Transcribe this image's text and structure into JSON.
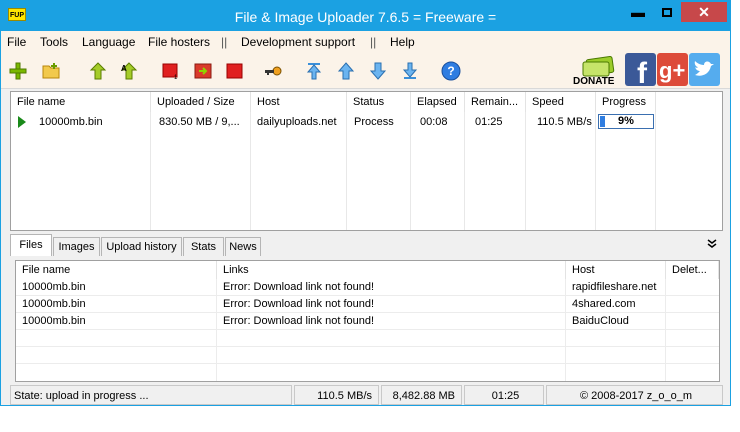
{
  "window": {
    "icon_text": "FUP",
    "title": "File & Image Uploader 7.6.5  = Freeware ="
  },
  "menu": [
    "File",
    "Tools",
    "Language",
    "File hosters",
    "||",
    "Development support",
    "||",
    "Help"
  ],
  "toolbar": {
    "donate_label": "DONATE"
  },
  "uploads": {
    "columns": [
      "File name",
      "Uploaded / Size",
      "Host",
      "Status",
      "Elapsed",
      "Remain...",
      "Speed",
      "Progress"
    ],
    "rows": [
      {
        "file": "10000mb.bin",
        "uploaded": "830.50 MB / 9,...",
        "host": "dailyuploads.net",
        "status": "Process",
        "elapsed": "00:08",
        "remaining": "01:25",
        "speed": "110.5 MB/s",
        "progress_label": "9%",
        "progress": 0.09
      }
    ]
  },
  "tabs": [
    "Files",
    "Images",
    "Upload history",
    "Stats",
    "News"
  ],
  "tabs_expand_icon": "double-chevron-down-icon",
  "links": {
    "columns": [
      "File name",
      "Links",
      "Host",
      "Delet..."
    ],
    "rows": [
      {
        "file": "10000mb.bin",
        "link": "Error: Download link not found!",
        "host": "rapidfileshare.net",
        "delete": ""
      },
      {
        "file": "10000mb.bin",
        "link": "Error: Download link not found!",
        "host": "4shared.com",
        "delete": ""
      },
      {
        "file": "10000mb.bin",
        "link": "Error: Download link not found!",
        "host": "BaiduCloud",
        "delete": ""
      }
    ]
  },
  "status": {
    "state": "State: upload in progress ...",
    "speed": "110.5 MB/s",
    "total": "8,482.88 MB",
    "time": "01:25",
    "copyright": "© 2008-2017 z_o_o_m"
  },
  "colors": {
    "titlebar": "#1ba1e2",
    "close": "#c7484a",
    "menubar": "#fbf3e9"
  }
}
